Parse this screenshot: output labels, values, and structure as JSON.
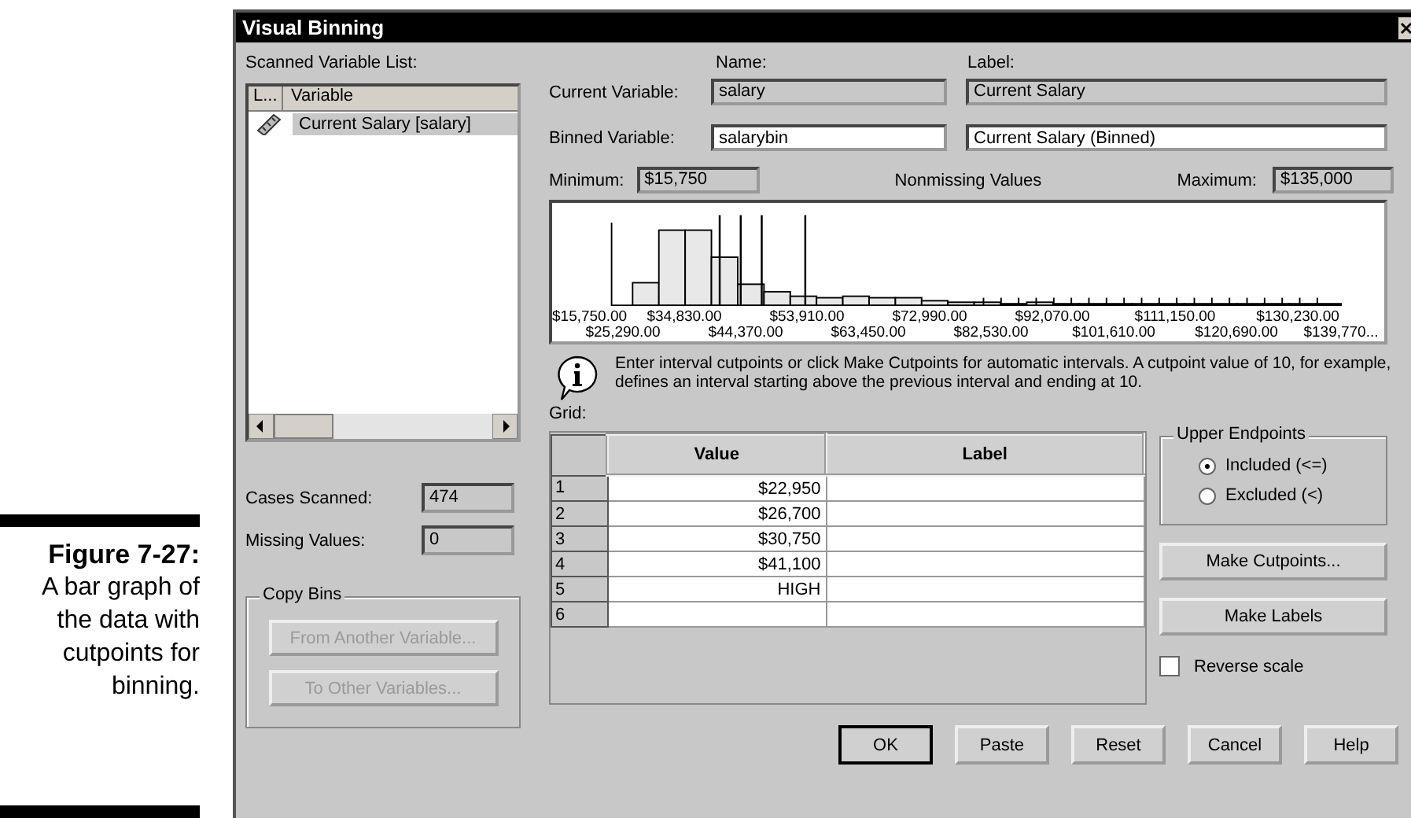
{
  "caption": {
    "label": "Figure 7-27:",
    "text": "A bar graph of the data with cutpoints for binning."
  },
  "window": {
    "title": "Visual Binning"
  },
  "scanned_list": {
    "label": "Scanned Variable List:",
    "columns": [
      "L...",
      "Variable"
    ],
    "items": [
      {
        "name": "Current Salary [salary]",
        "selected": true
      }
    ]
  },
  "cases_scanned": {
    "label": "Cases Scanned:",
    "value": "474"
  },
  "missing_values": {
    "label": "Missing Values:",
    "value": "0"
  },
  "copy_bins": {
    "title": "Copy Bins",
    "buttons": [
      {
        "label": "From Another Variable...",
        "disabled": true
      },
      {
        "label": "To Other Variables...",
        "disabled": true
      }
    ]
  },
  "headers": {
    "name": "Name:",
    "label": "Label:"
  },
  "current_variable": {
    "label": "Current Variable:",
    "name": "salary",
    "var_label": "Current Salary"
  },
  "binned_variable": {
    "label": "Binned Variable:",
    "name": "salarybin",
    "var_label": "Current Salary (Binned)"
  },
  "minimum": {
    "label": "Minimum:",
    "value": "$15,750"
  },
  "nonmissing": "Nonmissing Values",
  "maximum": {
    "label": "Maximum:",
    "value": "$135,000"
  },
  "histogram": {
    "ticks_top": [
      "$15,750.00",
      "$34,830.00",
      "$53,910.00",
      "$72,990.00",
      "$92,070.00",
      "$111,150.00",
      "$130,230.00"
    ],
    "ticks_bottom": [
      "$25,290.00",
      "$44,370.00",
      "$63,450.00",
      "$82,530.00",
      "$101,610.00",
      "$120,690.00",
      "$139,770..."
    ]
  },
  "info": "Enter interval cutpoints or click Make Cutpoints for automatic intervals.  A cutpoint value of 10, for example, defines an interval starting above the previous interval and ending at 10.",
  "grid": {
    "label": "Grid:",
    "columns": [
      "Value",
      "Label"
    ],
    "rows": [
      {
        "num": "1",
        "value": "$22,950"
      },
      {
        "num": "2",
        "value": "$26,700"
      },
      {
        "num": "3",
        "value": "$30,750"
      },
      {
        "num": "4",
        "value": "$41,100"
      },
      {
        "num": "5",
        "value": "HIGH"
      },
      {
        "num": "6",
        "value": ""
      }
    ]
  },
  "upper_endpoints": {
    "title": "Upper Endpoints",
    "options": [
      {
        "label": "Included (<=)",
        "selected": true
      },
      {
        "label": "Excluded (<)",
        "selected": false
      }
    ]
  },
  "side_buttons": [
    "Make Cutpoints...",
    "Make Labels"
  ],
  "reverse_scale": {
    "label": "Reverse scale",
    "checked": false
  },
  "buttons": [
    "OK",
    "Paste",
    "Reset",
    "Cancel",
    "Help"
  ]
}
